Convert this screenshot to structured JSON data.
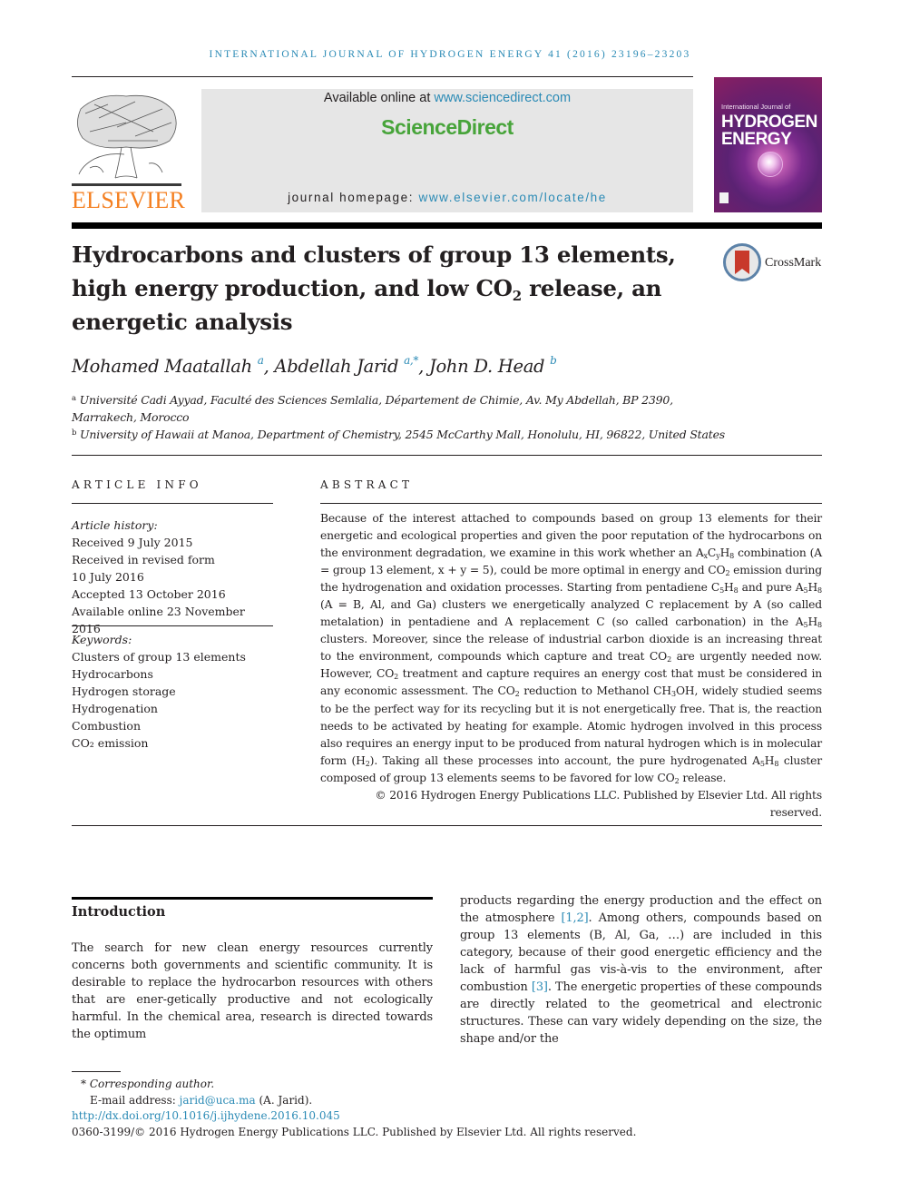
{
  "running_head": "International Journal of Hydrogen Energy 41 (2016) 23196–23203",
  "masthead": {
    "publisher_logo_word": "ELSEVIER",
    "available_prefix": "Available online at ",
    "available_link": "www.sciencedirect.com",
    "brand": "ScienceDirect",
    "homepage_prefix": "journal homepage: ",
    "homepage_link": "www.elsevier.com/locate/he",
    "cover": {
      "line1": "International Journal of",
      "line2": "HYDROGEN",
      "line3": "ENERGY"
    }
  },
  "article": {
    "title_part1": "Hydrocarbons and clusters of group 13 elements, high energy production, and low CO",
    "title_sub": "2",
    "title_part2": " release, an energetic analysis",
    "crossmark_label": "CrossMark",
    "authors": [
      {
        "name": "Mohamed Maatallah",
        "marks": "a"
      },
      {
        "name": "Abdellah Jarid",
        "marks": "a,*"
      },
      {
        "name": "John D. Head",
        "marks": "b"
      }
    ],
    "affiliations": [
      {
        "mark": "a",
        "line1": "Université Cadi Ayyad, Faculté des Sciences Semlalia, Département de Chimie, Av. My Abdellah, BP 2390,",
        "line2": "Marrakech, Morocco"
      },
      {
        "mark": "b",
        "line1": "University of Hawaii at Manoa, Department of Chemistry, 2545 McCarthy Mall, Honolulu, HI, 96822, United States"
      }
    ]
  },
  "article_info": {
    "heading": "ARTICLE INFO",
    "history_label": "Article history:",
    "history": [
      "Received 9 July 2015",
      "Received in revised form",
      "10 July 2016",
      "Accepted 13 October 2016",
      "Available online 23 November 2016"
    ],
    "keywords_label": "Keywords:",
    "keywords": [
      "Clusters of group 13 elements",
      "Hydrocarbons",
      "Hydrogen storage",
      "Hydrogenation",
      "Combustion",
      "CO₂ emission"
    ]
  },
  "abstract": {
    "heading": "ABSTRACT",
    "copyright": "© 2016 Hydrogen Energy Publications LLC. Published by Elsevier Ltd. All rights reserved."
  },
  "introduction": {
    "heading": "Introduction",
    "col1": "The search for new clean energy resources currently concerns both governments and scientific community. It is desirable to replace the hydrocarbon resources with others that are ener-getically productive and not ecologically harmful. In the chemical area, research is directed towards the optimum",
    "col2_a": "products regarding the energy production and the effect on the atmosphere ",
    "ref1": "[1,2]",
    "col2_b": ". Among others, compounds based on group 13 elements (B, Al, Ga, …) are included in this category, because of their good energetic efficiency and the lack of harmful gas vis-à-vis to the environment, after combustion ",
    "ref2": "[3]",
    "col2_c": ". The energetic properties of these compounds are directly related to the geometrical and electronic structures. These can vary widely depending on the size, the shape and/or the"
  },
  "footnotes": {
    "corresponding": "* Corresponding author.",
    "email_prefix": "E-mail address: ",
    "email": "jarid@uca.ma",
    "email_suffix": " (A. Jarid).",
    "doi": "http://dx.doi.org/10.1016/j.ijhydene.2016.10.045",
    "issn_line": "0360-3199/© 2016 Hydrogen Energy Publications LLC. Published by Elsevier Ltd. All rights reserved."
  },
  "colors": {
    "link": "#2a8ab5",
    "elsevier_orange": "#f47f20",
    "sciencedirect_green": "#47a43a",
    "masthead_gray": "#e6e6e6"
  }
}
